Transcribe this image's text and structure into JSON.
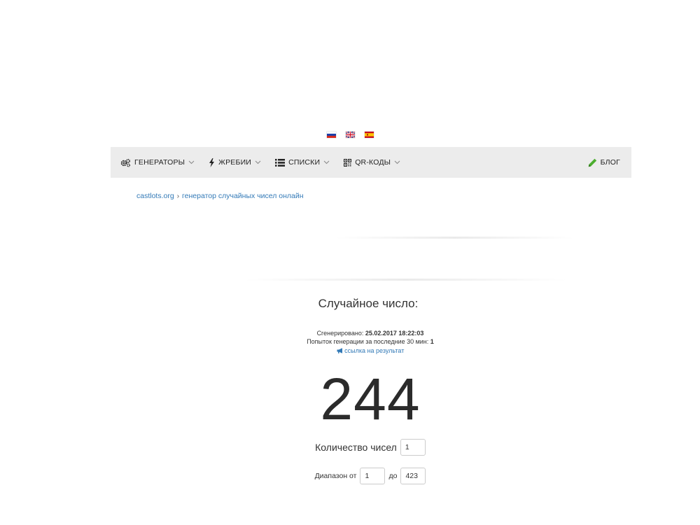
{
  "languages": [
    {
      "code": "ru",
      "icon": "flag-russia-icon"
    },
    {
      "code": "en",
      "icon": "flag-uk-icon"
    },
    {
      "code": "es",
      "icon": "flag-spain-icon"
    }
  ],
  "nav": {
    "items": [
      {
        "label": "ГЕНЕРАТОРЫ",
        "icon": "gears-icon"
      },
      {
        "label": "ЖРЕБИИ",
        "icon": "lightning-icon"
      },
      {
        "label": "СПИСКИ",
        "icon": "list-icon"
      },
      {
        "label": "QR-КОДЫ",
        "icon": "qr-code-icon"
      }
    ],
    "blog": {
      "label": "БЛОГ",
      "icon": "pencil-icon"
    },
    "blog_icon_color": "#4cae2f",
    "background": "#ececec"
  },
  "breadcrumb": {
    "home": "castlots.org",
    "current": "генератор случайных чисел онлайн"
  },
  "result": {
    "title": "Случайное число:",
    "generated_label": "Сгенерировано:",
    "generated_value": "25.02.2017 18:22:03",
    "attempts_label": "Попыток генерации за последние 30 мин:",
    "attempts_value": "1",
    "link_label": "ссылка на результат",
    "number": "244"
  },
  "form": {
    "count_label": "Количество чисел",
    "count_value": "1",
    "range_label": "Диапазон от",
    "range_from": "1",
    "range_to_label": "до",
    "range_to": "423"
  },
  "colors": {
    "link": "#337ab7",
    "text": "#333333"
  }
}
